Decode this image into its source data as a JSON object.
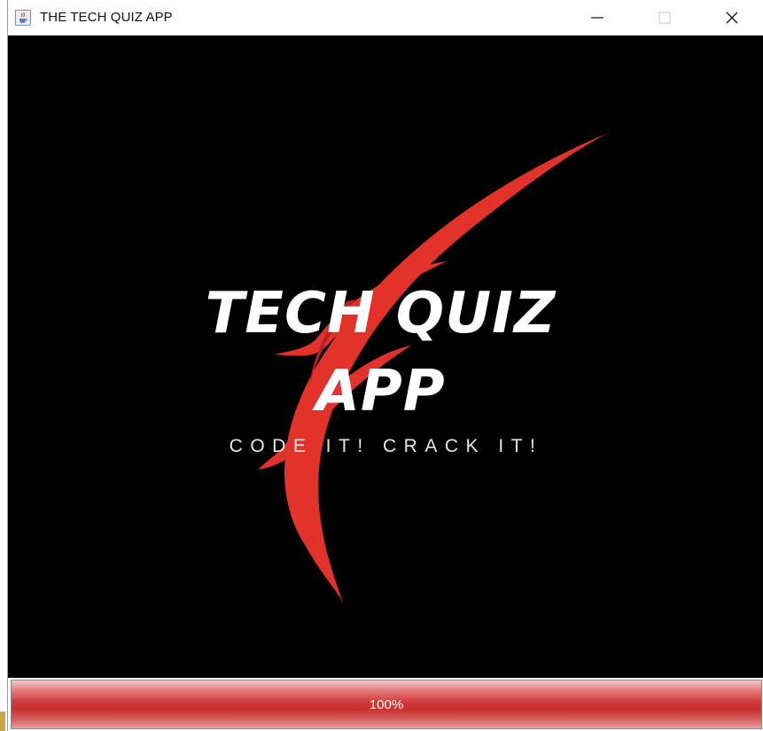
{
  "window": {
    "title": "THE TECH QUIZ APP",
    "icon": "java-cup-icon",
    "controls": [
      "minimize-icon",
      "maximize-icon",
      "close-icon"
    ]
  },
  "splash": {
    "title_line1": "TECH QUIZ",
    "title_line2": "APP",
    "tagline": "CODE IT! CRACK IT!",
    "logo": "red-lightning-slash-icon",
    "background_color": "#000000",
    "accent_color": "#e2322a"
  },
  "progress": {
    "label": "100%",
    "value": 100
  }
}
